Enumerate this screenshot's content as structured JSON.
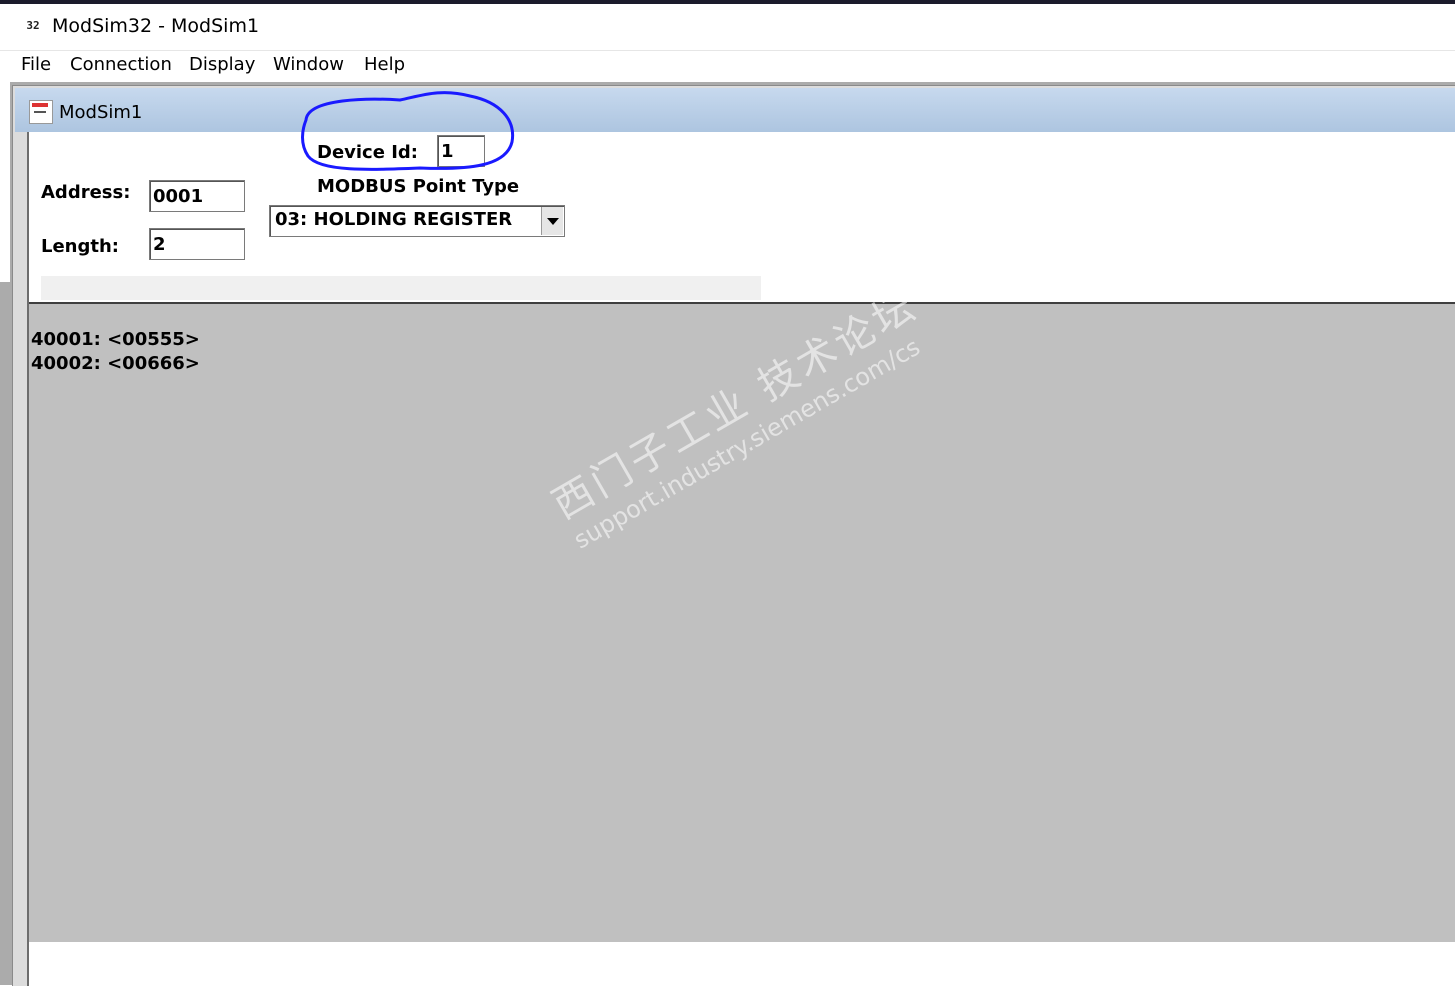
{
  "window": {
    "title": "ModSim32 - ModSim1",
    "icon": "modsim-app-icon",
    "icon_text": "32"
  },
  "menu": {
    "items": [
      "File",
      "Connection",
      "Display",
      "Window",
      "Help"
    ]
  },
  "child": {
    "title": "ModSim1",
    "icon": "document-icon"
  },
  "form": {
    "device_id_label": "Device Id:",
    "device_id_value": "1",
    "address_label": "Address:",
    "address_value": "0001",
    "length_label": "Length:",
    "length_value": "2",
    "point_type_label": "MODBUS Point Type",
    "point_type_value": "03: HOLDING REGISTER"
  },
  "registers": [
    "40001: <00555>",
    "40002: <00666>"
  ],
  "watermark": {
    "line1": "西门子工业 技术论坛",
    "line2": "support.industry.siemens.com/cs"
  },
  "colors": {
    "annotation": "#1a1aff",
    "caption_gradient_top": "#c7d9ee",
    "caption_gradient_bottom": "#adc5e0",
    "data_area": "#c0c0c0"
  }
}
